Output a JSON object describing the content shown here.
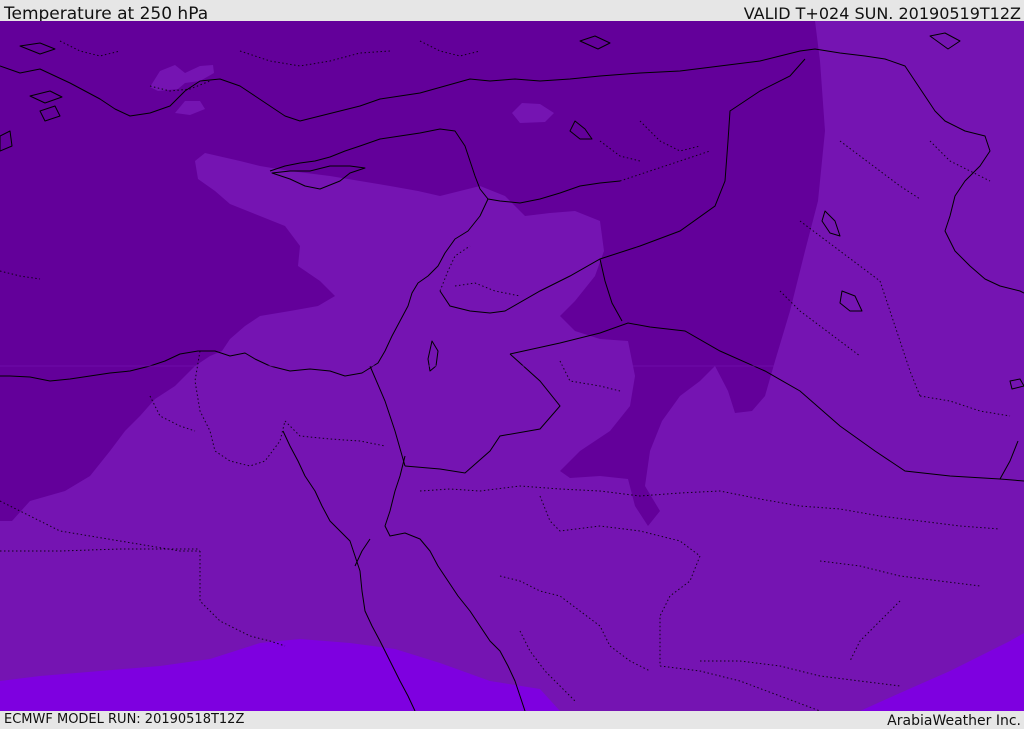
{
  "header": {
    "title": "Temperature at 250 hPa",
    "valid": "VALID T+024 SUN. 20190519T12Z"
  },
  "footer": {
    "model_run": "ECMWF MODEL RUN: 20190518T12Z",
    "credit": "ArabiaWeather Inc."
  },
  "colors": {
    "frame": "#e6e6e6",
    "cold_band": "#63009a",
    "mid_band": "#7514b2",
    "warm_band": "#7e00e0",
    "coastline": "#000000",
    "border": "#000000"
  }
}
